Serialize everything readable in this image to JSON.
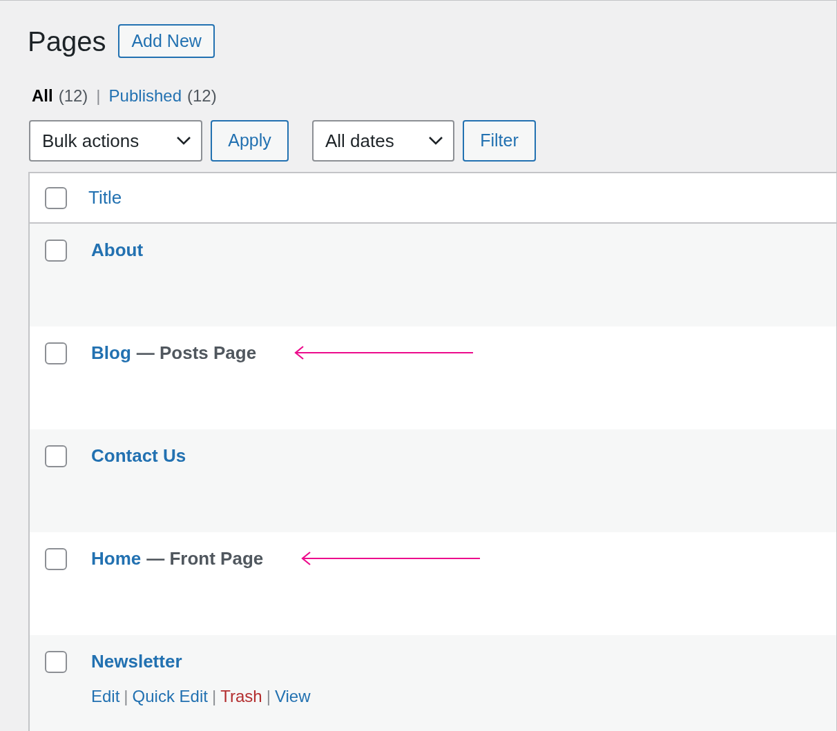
{
  "header": {
    "title": "Pages",
    "add_button": "Add New"
  },
  "views": [
    {
      "label": "All",
      "count": "(12)",
      "selected": true
    },
    {
      "label": "Published",
      "count": "(12)",
      "selected": false
    }
  ],
  "views_separator": "|",
  "bulk": {
    "select": "Bulk actions",
    "apply": "Apply"
  },
  "dates": {
    "select": "All dates",
    "filter": "Filter"
  },
  "table": {
    "column": "Title",
    "header_checked": false,
    "rows": [
      {
        "title": "About",
        "state": "",
        "checked": false,
        "annotated": false
      },
      {
        "title": "Blog",
        "state": "Posts Page",
        "checked": false,
        "annotated": true
      },
      {
        "title": "Contact Us",
        "state": "",
        "checked": false,
        "annotated": false
      },
      {
        "title": "Home",
        "state": "Front Page",
        "checked": false,
        "annotated": true
      },
      {
        "title": "Newsletter",
        "state": "",
        "checked": false,
        "annotated": false,
        "actions": [
          {
            "label": "Edit",
            "kind": "link"
          },
          {
            "label": "Quick Edit",
            "kind": "link"
          },
          {
            "label": "Trash",
            "kind": "delete"
          },
          {
            "label": "View",
            "kind": "link"
          }
        ]
      }
    ],
    "state_dash": "—",
    "action_separator": "|"
  }
}
